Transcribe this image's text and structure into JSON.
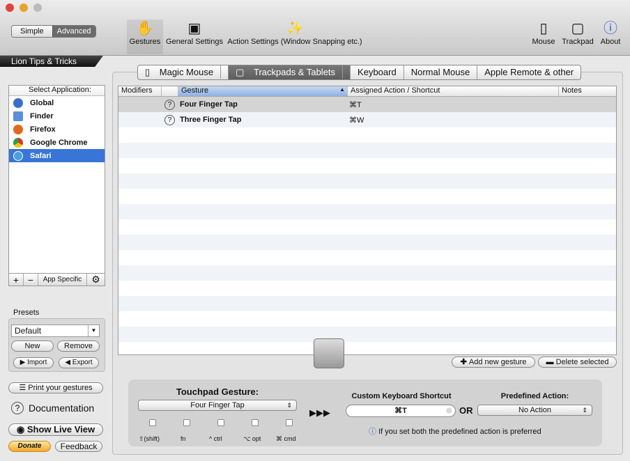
{
  "window": {
    "mode_simple": "Simple",
    "mode_advanced": "Advanced",
    "banner": "Lion Tips & Tricks"
  },
  "toolbar": {
    "items": [
      {
        "label": "Gestures",
        "icon": "hand-icon"
      },
      {
        "label": "General Settings",
        "icon": "switch-icon"
      },
      {
        "label": "Action Settings (Window Snapping etc.)",
        "icon": "magic-wand-icon"
      },
      {
        "label": "Mouse",
        "icon": "mouse-icon"
      },
      {
        "label": "Trackpad",
        "icon": "trackpad-icon"
      },
      {
        "label": "About",
        "icon": "info-icon"
      }
    ]
  },
  "sidebar": {
    "header": "Select Application:",
    "apps": [
      {
        "name": "Global",
        "color": "#3a6fc9"
      },
      {
        "name": "Finder",
        "color": "#5b8fd6"
      },
      {
        "name": "Firefox",
        "color": "#e06a1c"
      },
      {
        "name": "Google Chrome",
        "color": "#d33b2c"
      },
      {
        "name": "Safari",
        "color": "#4aa0dd"
      }
    ],
    "selected": "Safari",
    "add": "+",
    "remove": "−",
    "app_specific": "App Specific"
  },
  "presets": {
    "title": "Presets",
    "value": "Default",
    "new": "New",
    "remove": "Remove",
    "import": "Import",
    "export": "Export"
  },
  "links": {
    "print": "Print your gestures",
    "documentation": "Documentation",
    "live_view": "Show Live View",
    "donate": "Donate",
    "feedback": "Feedback"
  },
  "tabs": [
    "Magic Mouse",
    "Trackpads & Tablets",
    "Keyboard",
    "Normal Mouse",
    "Apple Remote & other"
  ],
  "active_tab": "Trackpads & Tablets",
  "table": {
    "columns": [
      "Modifiers",
      "Gesture",
      "Assigned Action / Shortcut",
      "Notes"
    ],
    "rows": [
      {
        "gesture": "Four Finger Tap",
        "action": "⌘T"
      },
      {
        "gesture": "Three Finger Tap",
        "action": "⌘W"
      }
    ]
  },
  "actions": {
    "add": "Add new gesture",
    "delete": "Delete selected"
  },
  "editor": {
    "gesture_label": "Touchpad Gesture:",
    "gesture_value": "Four Finger Tap",
    "modifiers": [
      "⇧(shift)",
      "fn",
      "^ ctrl",
      "⌥ opt",
      "⌘ cmd"
    ],
    "arrows": "▶▶▶",
    "shortcut_label": "Custom Keyboard Shortcut",
    "shortcut_value": "⌘T",
    "or": "OR",
    "predefined_label": "Predefined Action:",
    "predefined_value": "No Action",
    "hint": "If you set both the predefined action is preferred"
  }
}
